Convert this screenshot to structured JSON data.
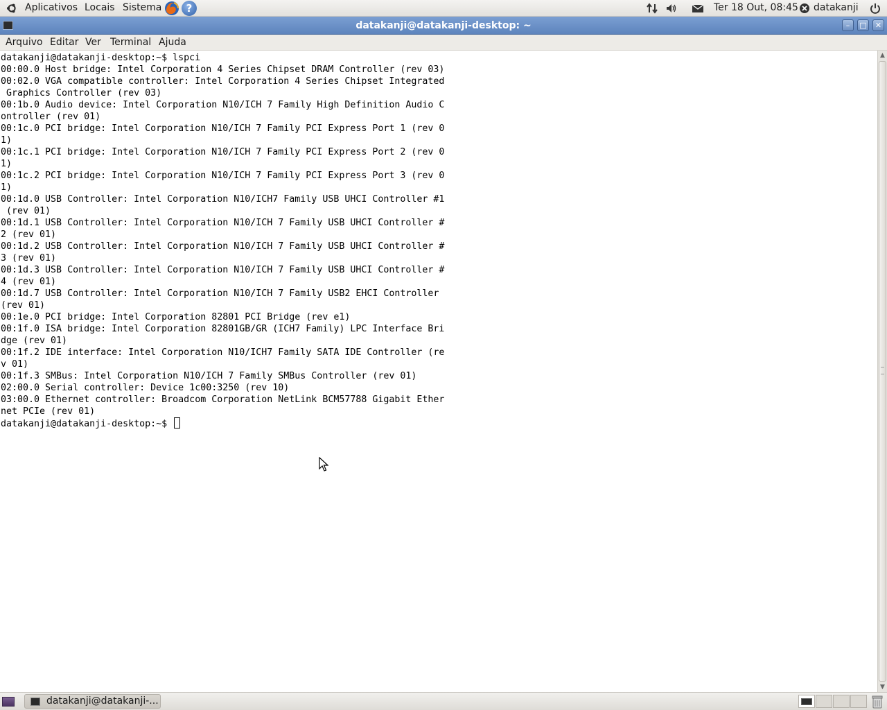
{
  "top_panel": {
    "menus": [
      "Aplicativos",
      "Locais",
      "Sistema"
    ],
    "datetime": "Ter 18 Out, 08:45",
    "username": "datakanji",
    "help_glyph": "?",
    "icons": [
      "ubuntu-logo-icon",
      "firefox-icon",
      "help-icon",
      "network-icon",
      "volume-icon",
      "mail-icon",
      "user-status-icon",
      "power-icon"
    ]
  },
  "window": {
    "title": "datakanji@datakanji-desktop: ~",
    "buttons": {
      "minimize": "–",
      "maximize": "□",
      "close": "✕"
    }
  },
  "menubar": {
    "items": [
      {
        "label": "Arquivo"
      },
      {
        "label": "Editar"
      },
      {
        "label": "Ver"
      },
      {
        "label": "Terminal"
      },
      {
        "label": "Ajuda"
      }
    ]
  },
  "terminal": {
    "lines": [
      "datakanji@datakanji-desktop:~$ lspci",
      "00:00.0 Host bridge: Intel Corporation 4 Series Chipset DRAM Controller (rev 03)",
      "00:02.0 VGA compatible controller: Intel Corporation 4 Series Chipset Integrated",
      " Graphics Controller (rev 03)",
      "00:1b.0 Audio device: Intel Corporation N10/ICH 7 Family High Definition Audio C",
      "ontroller (rev 01)",
      "00:1c.0 PCI bridge: Intel Corporation N10/ICH 7 Family PCI Express Port 1 (rev 0",
      "1)",
      "00:1c.1 PCI bridge: Intel Corporation N10/ICH 7 Family PCI Express Port 2 (rev 0",
      "1)",
      "00:1c.2 PCI bridge: Intel Corporation N10/ICH 7 Family PCI Express Port 3 (rev 0",
      "1)",
      "00:1d.0 USB Controller: Intel Corporation N10/ICH7 Family USB UHCI Controller #1",
      " (rev 01)",
      "00:1d.1 USB Controller: Intel Corporation N10/ICH 7 Family USB UHCI Controller #",
      "2 (rev 01)",
      "00:1d.2 USB Controller: Intel Corporation N10/ICH 7 Family USB UHCI Controller #",
      "3 (rev 01)",
      "00:1d.3 USB Controller: Intel Corporation N10/ICH 7 Family USB UHCI Controller #",
      "4 (rev 01)",
      "00:1d.7 USB Controller: Intel Corporation N10/ICH 7 Family USB2 EHCI Controller",
      "(rev 01)",
      "00:1e.0 PCI bridge: Intel Corporation 82801 PCI Bridge (rev e1)",
      "00:1f.0 ISA bridge: Intel Corporation 82801GB/GR (ICH7 Family) LPC Interface Bri",
      "dge (rev 01)",
      "00:1f.2 IDE interface: Intel Corporation N10/ICH7 Family SATA IDE Controller (re",
      "v 01)",
      "00:1f.3 SMBus: Intel Corporation N10/ICH 7 Family SMBus Controller (rev 01)",
      "02:00.0 Serial controller: Device 1c00:3250 (rev 10)",
      "03:00.0 Ethernet controller: Broadcom Corporation NetLink BCM57788 Gigabit Ether",
      "net PCIe (rev 01)"
    ],
    "prompt": "datakanji@datakanji-desktop:~$ "
  },
  "bottom_panel": {
    "task_label": "datakanji@datakanji-...",
    "workspaces": 4,
    "active_workspace": 1
  },
  "colors": {
    "titlebar": "#6a8fc7",
    "panel": "#e8e6e2",
    "terminal_bg": "#ffffff",
    "terminal_fg": "#000000"
  }
}
